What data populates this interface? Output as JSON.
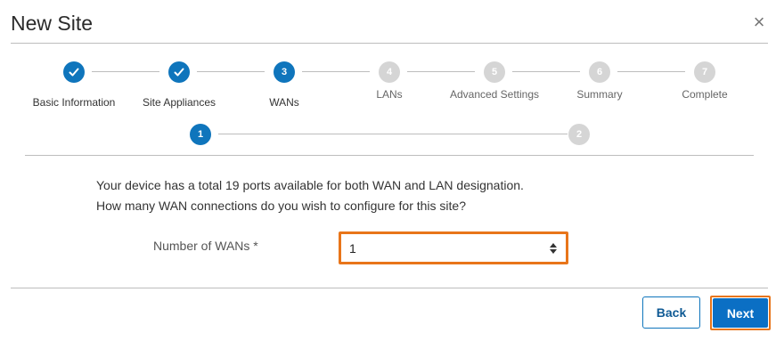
{
  "dialog": {
    "title": "New Site",
    "close_glyph": "×"
  },
  "stepper": {
    "steps": [
      {
        "number": "1",
        "label": "Basic Information",
        "state": "done"
      },
      {
        "number": "2",
        "label": "Site Appliances",
        "state": "done"
      },
      {
        "number": "3",
        "label": "WANs",
        "state": "active"
      },
      {
        "number": "4",
        "label": "LANs",
        "state": "todo"
      },
      {
        "number": "5",
        "label": "Advanced Settings",
        "state": "todo"
      },
      {
        "number": "6",
        "label": "Summary",
        "state": "todo"
      },
      {
        "number": "7",
        "label": "Complete",
        "state": "todo"
      }
    ],
    "substeps": [
      {
        "number": "1",
        "state": "active"
      },
      {
        "number": "2",
        "state": "todo"
      }
    ]
  },
  "form": {
    "description_line1": "Your device has a total 19 ports available for both WAN and LAN designation.",
    "description_line2": "How many WAN connections do you wish to configure for this site?",
    "wan_count_label": "Number of WANs *",
    "wan_count_value": "1"
  },
  "footer": {
    "back_label": "Back",
    "next_label": "Next"
  },
  "colors": {
    "primary": "#0f75bc",
    "highlight": "#e8751a",
    "inactive": "#d5d5d5"
  }
}
